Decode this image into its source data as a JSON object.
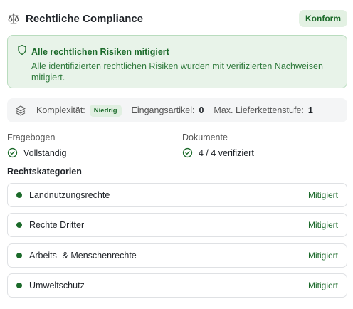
{
  "header": {
    "icon": "scale-icon",
    "title": "Rechtliche Compliance",
    "badge": "Konform"
  },
  "alert": {
    "icon": "shield-icon",
    "title": "Alle rechtlichen Risiken mitigiert",
    "body": "Alle identifizierten rechtlichen Risiken wurden mit verifizierten Nachweisen mitigiert."
  },
  "stats": {
    "icon": "layers-icon",
    "complexity_label": "Komplexität:",
    "complexity_value": "Niedrig",
    "input_items_label": "Eingangsartikel:",
    "input_items_value": "0",
    "supply_chain_label": "Max. Lieferkettenstufe:",
    "supply_chain_value": "1"
  },
  "questionnaire": {
    "label": "Fragebogen",
    "status": "Vollständig",
    "icon": "check-circle-icon"
  },
  "documents": {
    "label": "Dokumente",
    "status": "4 / 4 verifiziert",
    "icon": "check-circle-icon"
  },
  "categories": {
    "title": "Rechtskategorien",
    "items": [
      {
        "name": "Landnutzungsrechte",
        "status": "Mitigiert"
      },
      {
        "name": "Rechte Dritter",
        "status": "Mitigiert"
      },
      {
        "name": "Arbeits- & Menschenrechte",
        "status": "Mitigiert"
      },
      {
        "name": "Umweltschutz",
        "status": "Mitigiert"
      }
    ]
  },
  "colors": {
    "accent_green": "#1b6a2a",
    "alert_bg": "#e8f3e9",
    "badge_bg": "#e3f1e3"
  }
}
